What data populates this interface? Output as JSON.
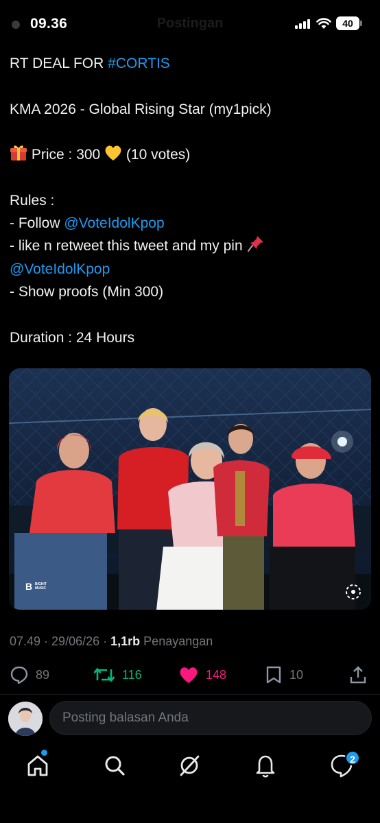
{
  "status_bar": {
    "time": "09.36",
    "header_title": "Postingan",
    "battery_level": "40"
  },
  "tweet": {
    "line1_prefix": "RT DEAL FOR ",
    "line1_hashtag": "#CORTIS",
    "line2": "KMA 2026 - Global Rising Star (my1pick)",
    "price_text": "Price : 300",
    "price_suffix": "(10 votes)",
    "rules_heading": "Rules :",
    "rule1_prefix": "- Follow ",
    "rule1_mention": "@VoteIdolKpop",
    "rule2": "- like n retweet this tweet and my pin",
    "rule2_mention": "@VoteIdolKpop",
    "rule3": "- Show proofs (Min 300)",
    "duration": "Duration : 24 Hours"
  },
  "photo": {
    "logo_mark": "B",
    "logo_text": "BIGHIT MUSIC"
  },
  "meta": {
    "time": "07.49",
    "separator": " · ",
    "date": "29/06/26",
    "views_count": "1,1rb",
    "views_label": "Penayangan"
  },
  "actions": {
    "replies": "89",
    "reposts": "116",
    "likes": "148",
    "bookmarks": "10"
  },
  "reply": {
    "placeholder": "Posting balasan Anda"
  },
  "nav": {
    "messages_badge": "2"
  },
  "colors": {
    "link": "#1d9bf0",
    "repost": "#00ba7c",
    "like": "#f91880",
    "muted": "#71767b"
  }
}
